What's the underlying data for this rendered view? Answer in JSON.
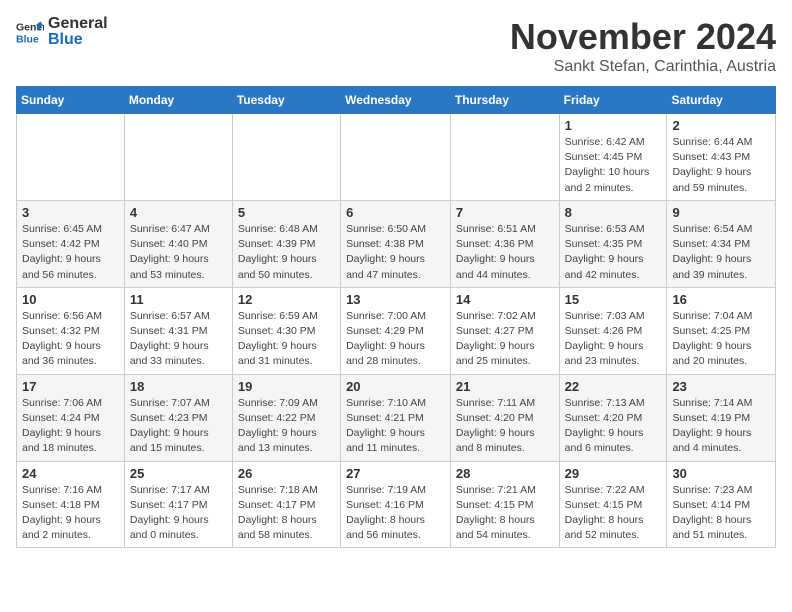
{
  "logo": {
    "general": "General",
    "blue": "Blue"
  },
  "title": "November 2024",
  "subtitle": "Sankt Stefan, Carinthia, Austria",
  "days_header": [
    "Sunday",
    "Monday",
    "Tuesday",
    "Wednesday",
    "Thursday",
    "Friday",
    "Saturday"
  ],
  "weeks": [
    [
      {
        "day": "",
        "info": ""
      },
      {
        "day": "",
        "info": ""
      },
      {
        "day": "",
        "info": ""
      },
      {
        "day": "",
        "info": ""
      },
      {
        "day": "",
        "info": ""
      },
      {
        "day": "1",
        "info": "Sunrise: 6:42 AM\nSunset: 4:45 PM\nDaylight: 10 hours and 2 minutes."
      },
      {
        "day": "2",
        "info": "Sunrise: 6:44 AM\nSunset: 4:43 PM\nDaylight: 9 hours and 59 minutes."
      }
    ],
    [
      {
        "day": "3",
        "info": "Sunrise: 6:45 AM\nSunset: 4:42 PM\nDaylight: 9 hours and 56 minutes."
      },
      {
        "day": "4",
        "info": "Sunrise: 6:47 AM\nSunset: 4:40 PM\nDaylight: 9 hours and 53 minutes."
      },
      {
        "day": "5",
        "info": "Sunrise: 6:48 AM\nSunset: 4:39 PM\nDaylight: 9 hours and 50 minutes."
      },
      {
        "day": "6",
        "info": "Sunrise: 6:50 AM\nSunset: 4:38 PM\nDaylight: 9 hours and 47 minutes."
      },
      {
        "day": "7",
        "info": "Sunrise: 6:51 AM\nSunset: 4:36 PM\nDaylight: 9 hours and 44 minutes."
      },
      {
        "day": "8",
        "info": "Sunrise: 6:53 AM\nSunset: 4:35 PM\nDaylight: 9 hours and 42 minutes."
      },
      {
        "day": "9",
        "info": "Sunrise: 6:54 AM\nSunset: 4:34 PM\nDaylight: 9 hours and 39 minutes."
      }
    ],
    [
      {
        "day": "10",
        "info": "Sunrise: 6:56 AM\nSunset: 4:32 PM\nDaylight: 9 hours and 36 minutes."
      },
      {
        "day": "11",
        "info": "Sunrise: 6:57 AM\nSunset: 4:31 PM\nDaylight: 9 hours and 33 minutes."
      },
      {
        "day": "12",
        "info": "Sunrise: 6:59 AM\nSunset: 4:30 PM\nDaylight: 9 hours and 31 minutes."
      },
      {
        "day": "13",
        "info": "Sunrise: 7:00 AM\nSunset: 4:29 PM\nDaylight: 9 hours and 28 minutes."
      },
      {
        "day": "14",
        "info": "Sunrise: 7:02 AM\nSunset: 4:27 PM\nDaylight: 9 hours and 25 minutes."
      },
      {
        "day": "15",
        "info": "Sunrise: 7:03 AM\nSunset: 4:26 PM\nDaylight: 9 hours and 23 minutes."
      },
      {
        "day": "16",
        "info": "Sunrise: 7:04 AM\nSunset: 4:25 PM\nDaylight: 9 hours and 20 minutes."
      }
    ],
    [
      {
        "day": "17",
        "info": "Sunrise: 7:06 AM\nSunset: 4:24 PM\nDaylight: 9 hours and 18 minutes."
      },
      {
        "day": "18",
        "info": "Sunrise: 7:07 AM\nSunset: 4:23 PM\nDaylight: 9 hours and 15 minutes."
      },
      {
        "day": "19",
        "info": "Sunrise: 7:09 AM\nSunset: 4:22 PM\nDaylight: 9 hours and 13 minutes."
      },
      {
        "day": "20",
        "info": "Sunrise: 7:10 AM\nSunset: 4:21 PM\nDaylight: 9 hours and 11 minutes."
      },
      {
        "day": "21",
        "info": "Sunrise: 7:11 AM\nSunset: 4:20 PM\nDaylight: 9 hours and 8 minutes."
      },
      {
        "day": "22",
        "info": "Sunrise: 7:13 AM\nSunset: 4:20 PM\nDaylight: 9 hours and 6 minutes."
      },
      {
        "day": "23",
        "info": "Sunrise: 7:14 AM\nSunset: 4:19 PM\nDaylight: 9 hours and 4 minutes."
      }
    ],
    [
      {
        "day": "24",
        "info": "Sunrise: 7:16 AM\nSunset: 4:18 PM\nDaylight: 9 hours and 2 minutes."
      },
      {
        "day": "25",
        "info": "Sunrise: 7:17 AM\nSunset: 4:17 PM\nDaylight: 9 hours and 0 minutes."
      },
      {
        "day": "26",
        "info": "Sunrise: 7:18 AM\nSunset: 4:17 PM\nDaylight: 8 hours and 58 minutes."
      },
      {
        "day": "27",
        "info": "Sunrise: 7:19 AM\nSunset: 4:16 PM\nDaylight: 8 hours and 56 minutes."
      },
      {
        "day": "28",
        "info": "Sunrise: 7:21 AM\nSunset: 4:15 PM\nDaylight: 8 hours and 54 minutes."
      },
      {
        "day": "29",
        "info": "Sunrise: 7:22 AM\nSunset: 4:15 PM\nDaylight: 8 hours and 52 minutes."
      },
      {
        "day": "30",
        "info": "Sunrise: 7:23 AM\nSunset: 4:14 PM\nDaylight: 8 hours and 51 minutes."
      }
    ]
  ]
}
